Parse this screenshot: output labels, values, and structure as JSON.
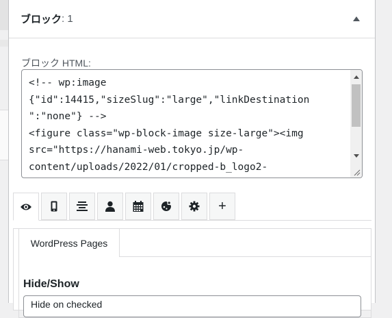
{
  "panel": {
    "title": "ブロック",
    "count": ": 1",
    "collapse_icon": "triangle-up-icon"
  },
  "block_html": {
    "label": "ブロック HTML:",
    "lines": [
      "<!-- wp:image",
      "{\"id\":14415,\"sizeSlug\":\"large\",\"linkDestination",
      "\":\"none\"} -->",
      "<figure class=\"wp-block-image size-large\"><img",
      "src=\"https://hanami-web.tokyo.jp/wp-",
      "content/uploads/2022/01/cropped-b_logo2-"
    ]
  },
  "tabs": [
    {
      "icon": "eye-icon",
      "active": true
    },
    {
      "icon": "mobile-icon",
      "active": false
    },
    {
      "icon": "align-center-icon",
      "active": false
    },
    {
      "icon": "user-icon",
      "active": false
    },
    {
      "icon": "calendar-icon",
      "active": false
    },
    {
      "icon": "color-palette-icon",
      "active": false
    },
    {
      "icon": "gear-icon",
      "active": false
    },
    {
      "icon": "plus-icon",
      "label": "+",
      "active": false
    }
  ],
  "visibility": {
    "subtab_label": "WordPress Pages",
    "hide_show_label": "Hide/Show",
    "select_value": "Hide on checked"
  },
  "colors": {
    "text": "#1d2327",
    "border": "#dcdcde",
    "background": "#f0f0f1"
  }
}
